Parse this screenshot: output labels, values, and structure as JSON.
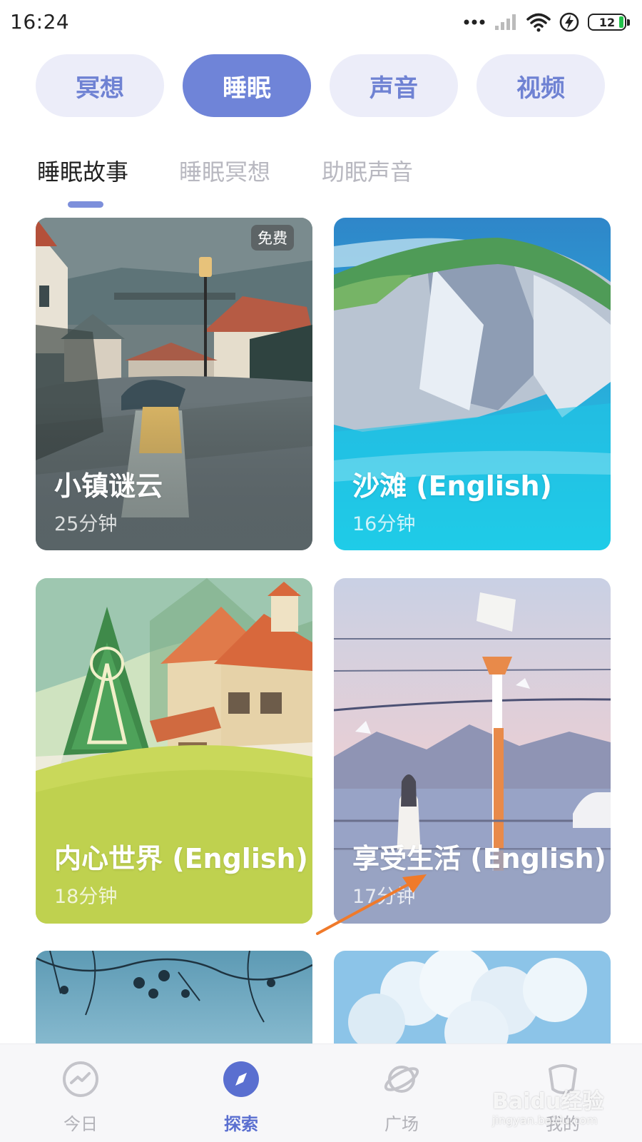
{
  "status_bar": {
    "time": "16:24",
    "battery": "12",
    "icons": [
      "more-dots-icon",
      "signal-icon",
      "wifi-icon",
      "charging-icon",
      "battery-icon"
    ]
  },
  "categories": [
    {
      "label": "冥想",
      "active": false
    },
    {
      "label": "睡眠",
      "active": true
    },
    {
      "label": "声音",
      "active": false
    },
    {
      "label": "视频",
      "active": false
    }
  ],
  "sub_tabs": [
    {
      "label": "睡眠故事",
      "active": true
    },
    {
      "label": "睡眠冥想",
      "active": false
    },
    {
      "label": "助眠声音",
      "active": false
    }
  ],
  "cards": [
    {
      "title": "小镇谜云",
      "duration": "25分钟",
      "badge": "免费"
    },
    {
      "title": "沙滩 (English)",
      "duration": "16分钟"
    },
    {
      "title": "内心世界 (English)",
      "duration": "18分钟"
    },
    {
      "title": "享受生活 (English)",
      "duration": "17分钟"
    }
  ],
  "bottom_nav": [
    {
      "label": "今日",
      "icon": "trend-icon",
      "active": false
    },
    {
      "label": "探索",
      "icon": "compass-icon",
      "active": true
    },
    {
      "label": "广场",
      "icon": "planet-icon",
      "active": false
    },
    {
      "label": "我的",
      "icon": "profile-icon",
      "active": false
    }
  ],
  "watermark": {
    "text": "Baidu经验",
    "sub": "jingyan.baidu.com"
  },
  "colors": {
    "accent": "#6f84d8",
    "pill_inactive_bg": "#ecedf9",
    "pill_inactive_text": "#6f82d3",
    "nav_active": "#5a6fd0",
    "annotation_arrow": "#f07a2a"
  }
}
